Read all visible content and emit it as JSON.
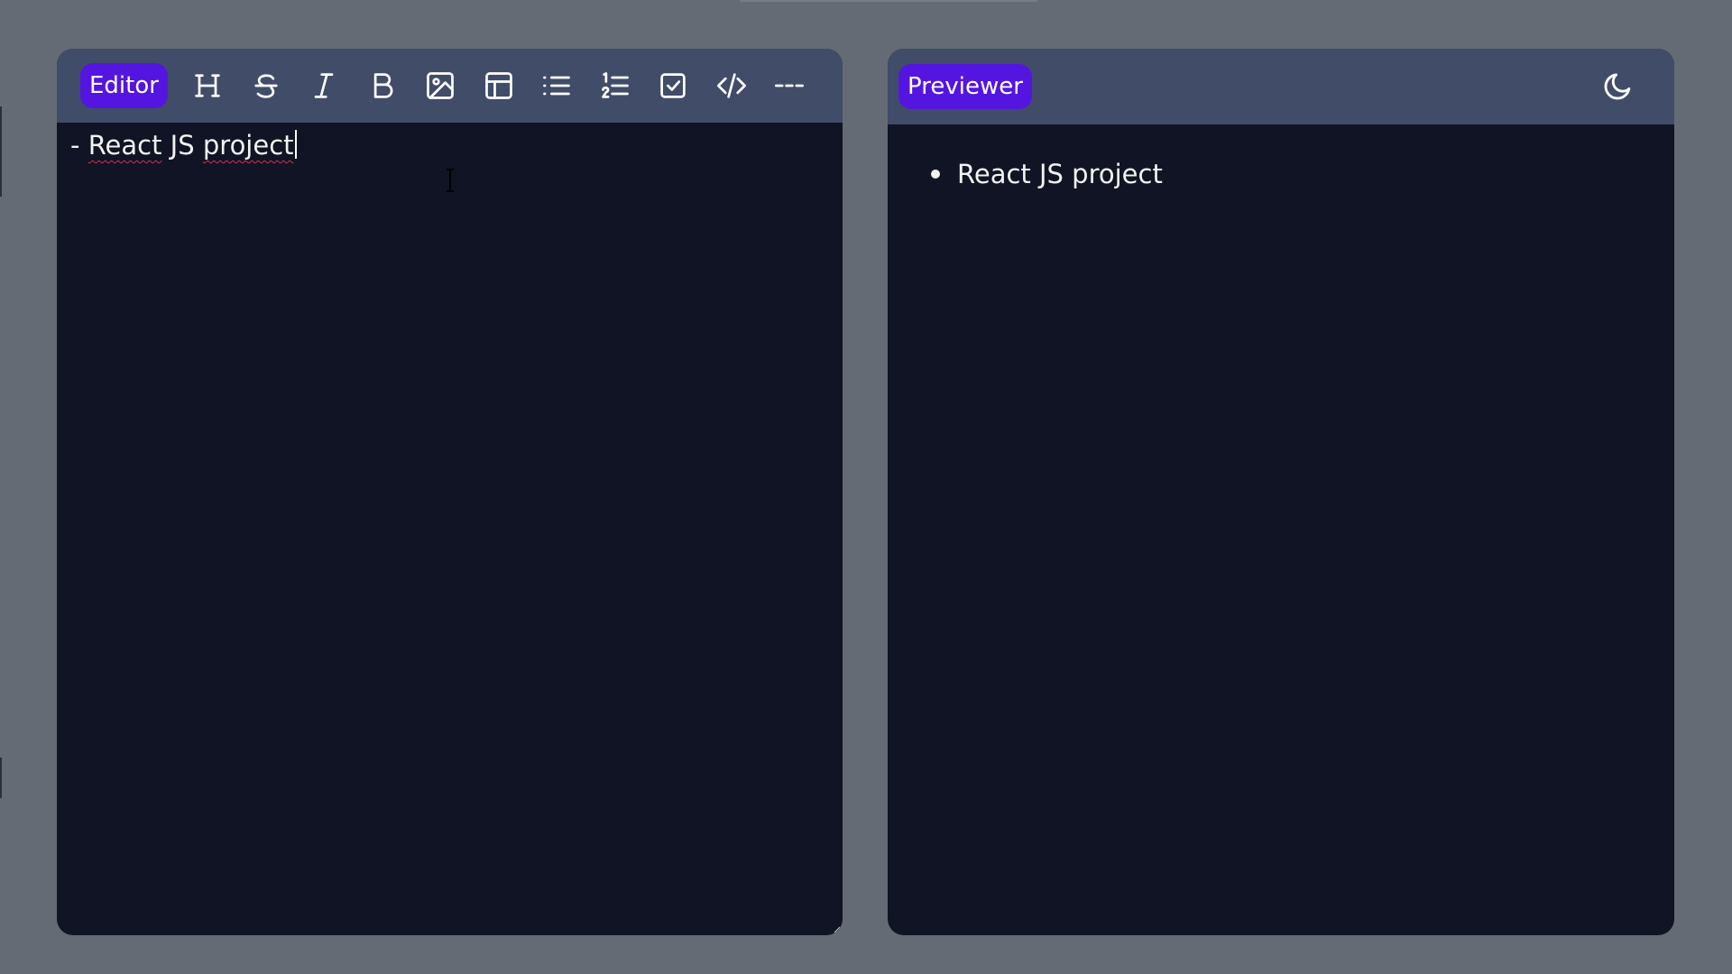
{
  "editor": {
    "label": "Editor",
    "text_prefix": "- ",
    "text_word1": "React",
    "text_middle": " JS ",
    "text_word2": "project",
    "toolbar": [
      {
        "name": "heading-icon"
      },
      {
        "name": "strikethrough-icon"
      },
      {
        "name": "italic-icon"
      },
      {
        "name": "bold-icon"
      },
      {
        "name": "image-icon"
      },
      {
        "name": "table-icon"
      },
      {
        "name": "bullet-list-icon"
      },
      {
        "name": "numbered-list-icon"
      },
      {
        "name": "checkbox-icon"
      },
      {
        "name": "code-icon"
      },
      {
        "name": "horizontal-rule-icon"
      }
    ]
  },
  "previewer": {
    "label": "Previewer",
    "theme_toggle_icon": "moon-icon",
    "items": [
      "React JS project"
    ]
  },
  "colors": {
    "background": "#656b75",
    "panel": "#101424",
    "toolbar": "#414c69",
    "accent": "#5515e0",
    "text": "#f2f2f2"
  }
}
